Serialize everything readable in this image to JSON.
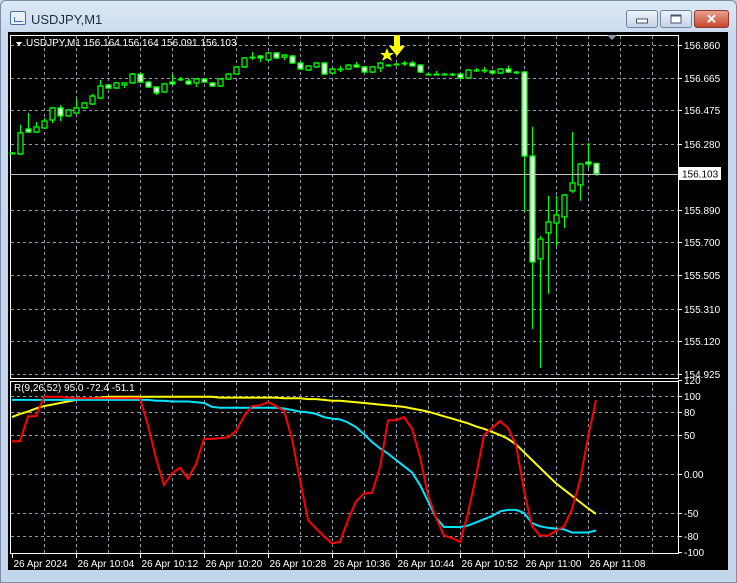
{
  "window": {
    "title": "USDJPY,M1",
    "minimize_label": "minimize",
    "maximize_label": "maximize",
    "close_label": "close"
  },
  "chart": {
    "header": "USDJPY,M1  156.164 156.164 156.091 156.103",
    "current_price": "156.103",
    "price_labels": [
      "156.860",
      "156.665",
      "156.475",
      "156.280",
      "155.890",
      "155.700",
      "155.505",
      "155.310",
      "155.120",
      "154.925"
    ],
    "time_labels": [
      "26 Apr 2024",
      "26 Apr 10:04",
      "26 Apr 10:12",
      "26 Apr 10:20",
      "26 Apr 10:28",
      "26 Apr 10:36",
      "26 Apr 10:44",
      "26 Apr 10:52",
      "26 Apr 11:00",
      "26 Apr 11:08"
    ],
    "colors": {
      "bull": "#00ff00",
      "bear_fill": "#ffffff",
      "grid": "#8c9bb0",
      "arrow": "#ffff00"
    }
  },
  "indicator": {
    "header": "R(9,26,52) 95.0 -72.4 -51.1",
    "axis_labels": [
      "120",
      "100",
      "80",
      "50",
      "0.00",
      "-50",
      "-80",
      "-100"
    ],
    "colors": {
      "fast": "#ff0000",
      "mid": "#00e5ff",
      "slow": "#ffff00"
    }
  },
  "chart_data": {
    "type": "candlestick",
    "symbol": "USDJPY",
    "timeframe": "M1",
    "ylim": [
      154.925,
      156.86
    ],
    "ohlc": [
      [
        156.225,
        156.231,
        156.219,
        156.225
      ],
      [
        156.219,
        156.39,
        156.213,
        156.343
      ],
      [
        156.366,
        156.46,
        156.343,
        156.348
      ],
      [
        156.348,
        156.407,
        156.343,
        156.378
      ],
      [
        156.372,
        156.431,
        156.366,
        156.413
      ],
      [
        156.419,
        156.496,
        156.401,
        156.49
      ],
      [
        156.49,
        156.507,
        156.413,
        156.443
      ],
      [
        156.443,
        156.484,
        156.437,
        156.478
      ],
      [
        156.46,
        156.542,
        156.454,
        156.49
      ],
      [
        156.49,
        156.525,
        156.484,
        156.519
      ],
      [
        156.513,
        156.572,
        156.507,
        156.56
      ],
      [
        156.548,
        156.654,
        156.542,
        156.619
      ],
      [
        156.625,
        156.631,
        156.601,
        156.607
      ],
      [
        156.607,
        156.642,
        156.601,
        156.637
      ],
      [
        156.625,
        156.642,
        156.607,
        156.637
      ],
      [
        156.637,
        156.695,
        156.631,
        156.689
      ],
      [
        156.689,
        156.695,
        156.637,
        156.642
      ],
      [
        156.642,
        156.648,
        156.607,
        156.613
      ],
      [
        156.613,
        156.619,
        156.566,
        156.578
      ],
      [
        156.584,
        156.637,
        156.578,
        156.631
      ],
      [
        156.642,
        156.689,
        156.625,
        156.631
      ],
      [
        156.66,
        156.672,
        156.648,
        156.66
      ],
      [
        156.648,
        156.666,
        156.625,
        156.631
      ],
      [
        156.637,
        156.666,
        156.613,
        156.66
      ],
      [
        156.66,
        156.666,
        156.637,
        156.642
      ],
      [
        156.637,
        156.642,
        156.613,
        156.619
      ],
      [
        156.619,
        156.666,
        156.613,
        156.66
      ],
      [
        156.66,
        156.695,
        156.654,
        156.689
      ],
      [
        156.689,
        156.737,
        156.684,
        156.731
      ],
      [
        156.731,
        156.789,
        156.725,
        156.784
      ],
      [
        156.789,
        156.819,
        156.772,
        156.789
      ],
      [
        156.795,
        156.801,
        156.76,
        156.784
      ],
      [
        156.772,
        156.819,
        156.766,
        156.813
      ],
      [
        156.813,
        156.819,
        156.778,
        156.784
      ],
      [
        156.789,
        156.807,
        156.772,
        156.801
      ],
      [
        156.795,
        156.801,
        156.748,
        156.754
      ],
      [
        156.754,
        156.76,
        156.713,
        156.719
      ],
      [
        156.713,
        156.742,
        156.707,
        156.737
      ],
      [
        156.731,
        156.76,
        156.725,
        156.754
      ],
      [
        156.754,
        156.76,
        156.684,
        156.689
      ],
      [
        156.695,
        156.725,
        156.689,
        156.719
      ],
      [
        156.719,
        156.737,
        156.701,
        156.719
      ],
      [
        156.719,
        156.748,
        156.713,
        156.742
      ],
      [
        156.742,
        156.76,
        156.725,
        156.731
      ],
      [
        156.731,
        156.737,
        156.695,
        156.701
      ],
      [
        156.701,
        156.737,
        156.695,
        156.731
      ],
      [
        156.725,
        156.76,
        156.701,
        156.754
      ],
      [
        156.742,
        156.748,
        156.737,
        156.742
      ],
      [
        156.748,
        156.754,
        156.742,
        156.748
      ],
      [
        156.754,
        156.766,
        156.737,
        156.754
      ],
      [
        156.754,
        156.766,
        156.731,
        156.737
      ],
      [
        156.742,
        156.748,
        156.695,
        156.701
      ],
      [
        156.689,
        156.695,
        156.684,
        156.689
      ],
      [
        156.689,
        156.707,
        156.684,
        156.689
      ],
      [
        156.689,
        156.695,
        156.684,
        156.689
      ],
      [
        156.689,
        156.695,
        156.678,
        156.689
      ],
      [
        156.689,
        156.695,
        156.66,
        156.666
      ],
      [
        156.666,
        156.719,
        156.66,
        156.713
      ],
      [
        156.713,
        156.725,
        156.701,
        156.713
      ],
      [
        156.713,
        156.731,
        156.695,
        156.713
      ],
      [
        156.707,
        156.713,
        156.689,
        156.695
      ],
      [
        156.695,
        156.725,
        156.689,
        156.719
      ],
      [
        156.719,
        156.737,
        156.695,
        156.701
      ],
      [
        156.701,
        156.707,
        156.689,
        156.701
      ],
      [
        156.701,
        156.707,
        155.878,
        156.207
      ],
      [
        156.207,
        156.378,
        155.19,
        155.584
      ],
      [
        155.602,
        155.737,
        154.961,
        155.719
      ],
      [
        155.755,
        155.972,
        155.396,
        155.819
      ],
      [
        155.813,
        155.972,
        155.678,
        155.86
      ],
      [
        155.849,
        155.984,
        155.784,
        155.978
      ],
      [
        156.002,
        156.348,
        155.99,
        156.049
      ],
      [
        156.037,
        156.166,
        155.943,
        156.16
      ],
      [
        156.172,
        156.284,
        156.137,
        156.16
      ],
      [
        156.164,
        156.164,
        156.091,
        156.103
      ]
    ],
    "indicator_ylim": [
      -100,
      120
    ],
    "series": [
      {
        "name": "fast",
        "values": [
          42,
          42,
          74,
          74,
          99,
          99,
          99,
          98,
          97,
          97,
          97,
          97,
          97,
          97,
          97,
          97,
          97,
          62,
          20,
          -14,
          1,
          8,
          -6,
          13,
          45,
          45,
          46,
          47,
          55,
          74,
          87,
          88,
          92,
          87,
          81,
          45,
          -8,
          -59,
          -70,
          -80,
          -89,
          -87,
          -59,
          -35,
          -25,
          -24,
          9,
          69,
          69,
          73,
          58,
          22,
          -27,
          -56,
          -79,
          -82,
          -87,
          -50,
          -3,
          50,
          59,
          68,
          59,
          37,
          -21,
          -67,
          -79,
          -79,
          -73,
          -67,
          -45,
          -8,
          47,
          95.0
        ]
      },
      {
        "name": "mid",
        "values": [
          95,
          95,
          95,
          95,
          95,
          95,
          95,
          95,
          95,
          95,
          95,
          95,
          95,
          95,
          95,
          95,
          95,
          95,
          94,
          94,
          93,
          93,
          93,
          92,
          91,
          86,
          85,
          85,
          85,
          85,
          85,
          85,
          85,
          85,
          84,
          82,
          80,
          79,
          77,
          73,
          71,
          70,
          66,
          60,
          51,
          41,
          33,
          26,
          18,
          10,
          2,
          -14,
          -35,
          -56,
          -68,
          -68,
          -68,
          -66,
          -62,
          -58,
          -54,
          -48,
          -46,
          -46,
          -50,
          -63,
          -67,
          -69,
          -70,
          -71,
          -75,
          -75,
          -75,
          -72.4
        ]
      },
      {
        "name": "slow",
        "values": [
          73,
          77,
          80,
          84,
          87,
          89,
          91,
          93,
          95,
          96,
          97,
          98,
          99,
          99,
          99,
          99,
          99,
          99,
          99,
          99,
          99,
          99,
          99,
          99,
          99,
          99,
          98,
          98,
          98,
          98,
          98,
          98,
          98,
          98,
          97,
          97,
          97,
          96,
          96,
          95,
          94,
          94,
          93,
          92,
          91,
          90,
          89,
          88,
          87,
          86,
          84,
          82,
          80,
          77,
          74,
          71,
          68,
          65,
          61,
          58,
          54,
          50,
          45,
          38,
          28,
          18,
          8,
          -2,
          -12,
          -20,
          -28,
          -36,
          -44,
          -51.1
        ]
      }
    ]
  }
}
